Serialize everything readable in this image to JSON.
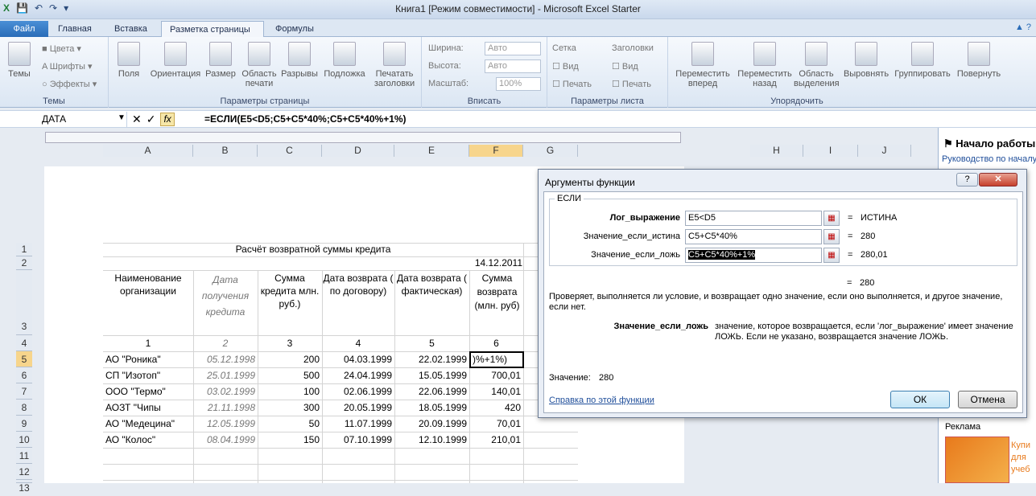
{
  "window": {
    "title": "Книга1  [Режим совместимости]  -  Microsoft Excel Starter",
    "qat": [
      "save-icon",
      "undo-icon",
      "redo-icon"
    ]
  },
  "tabs": [
    "Файл",
    "Главная",
    "Вставка",
    "Разметка страницы",
    "Формулы"
  ],
  "ribbon": {
    "themes": {
      "label": "Темы",
      "btn": "Темы",
      "colors": "Цвета",
      "fonts": "Шрифты",
      "effects": "Эффекты"
    },
    "page_setup": {
      "label": "Параметры страницы",
      "buttons": [
        "Поля",
        "Ориентация",
        "Размер",
        "Область печати",
        "Разрывы",
        "Подложка",
        "Печатать заголовки"
      ]
    },
    "fit": {
      "label": "Вписать",
      "width_label": "Ширина:",
      "width_val": "Авто",
      "height_label": "Высота:",
      "height_val": "Авто",
      "scale_label": "Масштаб:",
      "scale_val": "100%"
    },
    "sheet_opts": {
      "label": "Параметры листа",
      "grid": "Сетка",
      "headers": "Заголовки",
      "view1": "Вид",
      "print1": "Печать",
      "view2": "Вид",
      "print2": "Печать"
    },
    "arrange": {
      "label": "Упорядочить",
      "buttons": [
        "Переместить вперед",
        "Переместить назад",
        "Область выделения",
        "Выровнять",
        "Группировать",
        "Повернуть"
      ]
    }
  },
  "formula_bar": {
    "name_box": "ДАТА",
    "formula": "=ЕСЛИ(E5<D5;C5+C5*40%;C5+C5*40%+1%)"
  },
  "columns": [
    "A",
    "B",
    "C",
    "D",
    "E",
    "F",
    "G",
    "H",
    "I",
    "J"
  ],
  "rows": [
    "1",
    "2",
    "3",
    "4",
    "5",
    "6",
    "7",
    "8",
    "9",
    "10",
    "11",
    "12",
    "13"
  ],
  "sheet": {
    "title": "Расчёт возвратной суммы кредита",
    "date": "14.12.2011",
    "headers": {
      "a": "Наименование организации",
      "b": "Дата получения кредита",
      "c": "Сумма кредита млн. руб.)",
      "d": "Дата возврата ( по договору)",
      "e": "Дата возврата ( фактическая)",
      "f": "Сумма возврата (млн. руб)"
    },
    "nums": [
      "1",
      "2",
      "3",
      "4",
      "5",
      "6"
    ],
    "data": [
      [
        "АО \"Роника\"",
        "05.12.1998",
        "200",
        "04.03.1999",
        "22.02.1999",
        ")%+1%)"
      ],
      [
        "СП \"Изотоп\"",
        "25.01.1999",
        "500",
        "24.04.1999",
        "15.05.1999",
        "700,01"
      ],
      [
        "ООО \"Термо\"",
        "03.02.1999",
        "100",
        "02.06.1999",
        "22.06.1999",
        "140,01"
      ],
      [
        "АОЗТ \"Чипы",
        "21.11.1998",
        "300",
        "20.05.1999",
        "18.05.1999",
        "420"
      ],
      [
        "АО \"Медецина\"",
        "12.05.1999",
        "50",
        "11.07.1999",
        "20.09.1999",
        "70,01"
      ],
      [
        "АО \"Колос\"",
        "08.04.1999",
        "150",
        "07.10.1999",
        "12.10.1999",
        "210,01"
      ]
    ]
  },
  "side_panel": {
    "title": "Начало работы",
    "link": "Руководство по началу",
    "ads": "Реклама",
    "ad_text": "Купи для учеб"
  },
  "dialog": {
    "title": "Аргументы функции",
    "func": "ЕСЛИ",
    "args": [
      {
        "label": "Лог_выражение",
        "value": "E5<D5",
        "result": "ИСТИНА"
      },
      {
        "label": "Значение_если_истина",
        "value": "C5+C5*40%",
        "result": "280"
      },
      {
        "label": "Значение_если_ложь",
        "value": "C5+C5*40%+1%",
        "result": "280,01"
      }
    ],
    "total": "280",
    "desc": "Проверяет, выполняется ли условие, и возвращает одно значение, если оно выполняется, и другое значение, если нет.",
    "arg_desc_label": "Значение_если_ложь",
    "arg_desc": "значение, которое возвращается, если 'лог_выражение' имеет значение ЛОЖЬ. Если не указано, возвращается значение ЛОЖЬ.",
    "value_label": "Значение:",
    "value": "280",
    "help_link": "Справка по этой функции",
    "ok": "ОК",
    "cancel": "Отмена",
    "eq": "="
  }
}
